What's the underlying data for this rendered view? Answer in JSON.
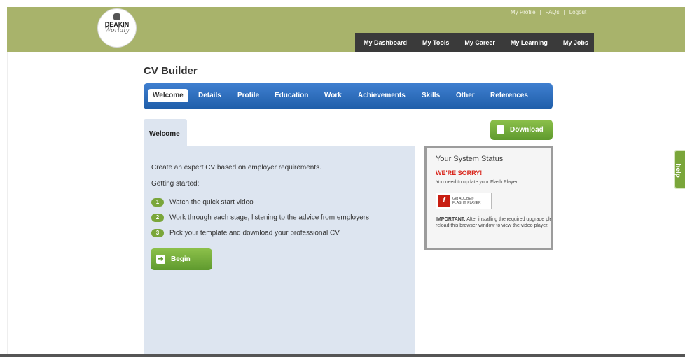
{
  "header": {
    "logo": {
      "text1": "DEAKIN",
      "text2": "Worldly"
    },
    "top_links": [
      "My Profile",
      "FAQs",
      "Logout"
    ],
    "separator": "|",
    "main_nav": [
      "My Dashboard",
      "My Tools",
      "My Career",
      "My Learning",
      "My Jobs"
    ]
  },
  "page_title": "CV Builder",
  "tabs": [
    "Welcome",
    "Details",
    "Profile",
    "Education",
    "Work",
    "Achievements",
    "Skills",
    "Other",
    "References"
  ],
  "active_tab": "Welcome",
  "content": {
    "tab_label": "Welcome",
    "intro": "Create an expert CV based on employer requirements.",
    "getting_started": "Getting started:",
    "steps": [
      {
        "num": "1",
        "text": "Watch the quick start video"
      },
      {
        "num": "2",
        "text": "Work through each stage, listening to the advice from employers"
      },
      {
        "num": "3",
        "text": "Pick your template and download your professional CV"
      }
    ],
    "begin_label": "Begin",
    "download_label": "Download"
  },
  "system_status": {
    "title": "Your System Status",
    "sorry": "WE'RE SORRY!",
    "update_msg": "You need to update your Flash Player.",
    "badge_line1": "Get ADOBE®",
    "badge_line2": "FLASH® PLAYER",
    "important_label": "IMPORTANT:",
    "important_text": "After installing the required upgrade please reload this browser window to view the video player."
  },
  "help_label": "help",
  "icons": [
    "arrow-right-icon",
    "document-icon",
    "flash-player-icon"
  ],
  "colors": {
    "header_bg": "#a8b36b",
    "tab_bar": "#2a6bbd",
    "accent_green": "#7aa63a",
    "panel_bg": "#dde5f0",
    "error_red": "#d9261c"
  }
}
